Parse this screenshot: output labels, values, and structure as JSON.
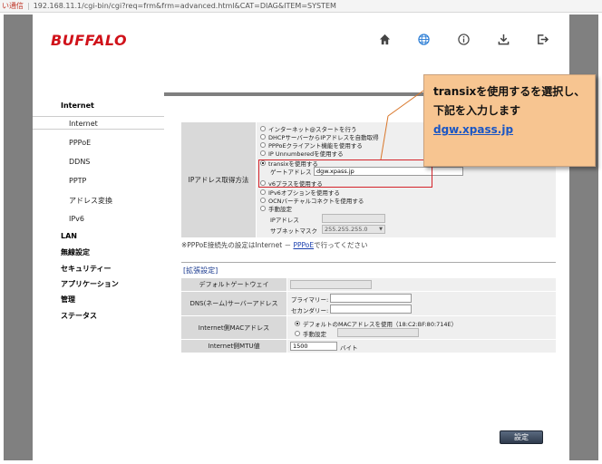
{
  "address_bar": {
    "warning": "い通信",
    "url": "192.168.11.1/cgi-bin/cgi?req=frm&frm=advanced.html&CAT=DIAG&ITEM=SYSTEM"
  },
  "header": {
    "logo": "BUFFALO",
    "icons": [
      "home-icon",
      "globe-icon",
      "info-icon",
      "download-icon",
      "logout-icon"
    ]
  },
  "nav": {
    "items": [
      {
        "label": "Internet",
        "bold": true
      },
      {
        "label": "Internet",
        "bold": false,
        "active": true
      },
      {
        "label": "PPPoE",
        "bold": false
      },
      {
        "label": "DDNS",
        "bold": false
      },
      {
        "label": "PPTP",
        "bold": false
      },
      {
        "label": "アドレス変換",
        "bold": false
      },
      {
        "label": "IPv6",
        "bold": false
      },
      {
        "label": "LAN",
        "bold": true
      },
      {
        "label": "無線設定",
        "bold": true
      },
      {
        "label": "セキュリティー",
        "bold": true
      },
      {
        "label": "アプリケーション",
        "bold": true
      },
      {
        "label": "管理",
        "bold": true
      },
      {
        "label": "ステータス",
        "bold": true
      }
    ]
  },
  "ip_method": {
    "label": "IPアドレス取得方法",
    "options": [
      "インターネット@スタートを行う",
      "DHCPサーバーからIPアドレスを自動取得",
      "PPPoEクライアント機能を使用する",
      "IP Unnumberedを使用する",
      "transixを使用する",
      "v6プラスを使用する",
      "IPv6オプションを使用する",
      "OCNバーチャルコネクトを使用する",
      "手動設定"
    ],
    "selected_index": 4,
    "gateway_label": "ゲートアドレス",
    "gateway_value": "dgw.xpass.jp",
    "ip_label": "IPアドレス",
    "ip_value": "",
    "subnet_label": "サブネットマスク",
    "subnet_value": "255.255.255.0"
  },
  "note": {
    "prefix": "※PPPoE接続先の設定はInternet － ",
    "link": "PPPoE",
    "suffix": "で行ってください"
  },
  "extended": {
    "title": "[拡張設定]",
    "default_gateway_label": "デフォルトゲートウェイ",
    "default_gateway_value": "",
    "dns_label": "DNS(ネーム)サーバーアドレス",
    "dns_primary_label": "プライマリー:",
    "dns_primary_value": "",
    "dns_secondary_label": "セカンダリー:",
    "dns_secondary_value": "",
    "mac_label": "Internet側MACアドレス",
    "mac_default_option": "デフォルトのMACアドレスを使用（18:C2:BF:80:714E）",
    "mac_manual_option": "手動設定",
    "mac_manual_value": "",
    "mtu_label": "Internet側MTU値",
    "mtu_value": "1500",
    "mtu_unit": "バイト"
  },
  "callout": {
    "line1": "transixを使用するを選択し、",
    "line2": "下記を入力します",
    "link": "dgw.xpass.jp"
  },
  "buttons": {
    "submit": "設定"
  },
  "colors": {
    "brand": "#d0121a",
    "callout_bg": "#f7c591",
    "highlight_border": "#d4232a"
  }
}
